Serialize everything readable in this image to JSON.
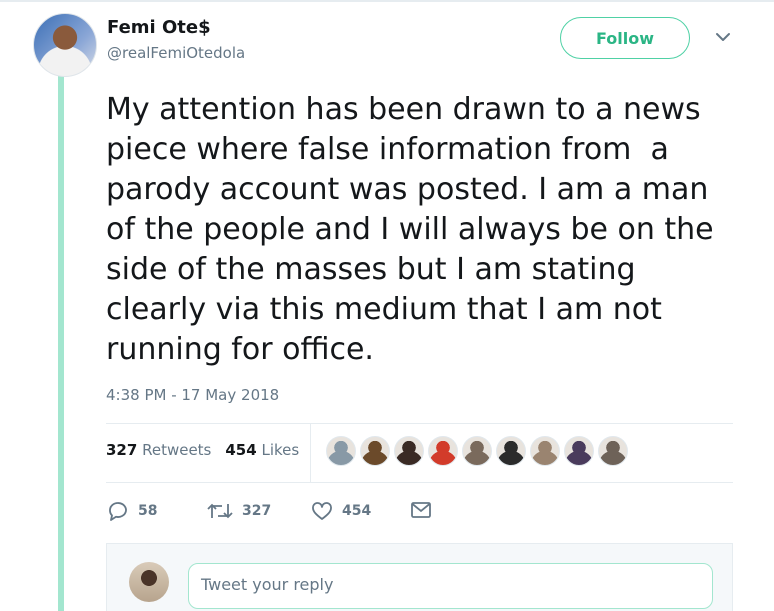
{
  "author": {
    "name": "Femi Ote$",
    "handle": "@realFemiOtedola"
  },
  "follow_button": {
    "label": "Follow"
  },
  "menu": {
    "icon": "chevron-down-icon"
  },
  "tweet": {
    "text": "My attention has been drawn to a news\npiece where false information from  a\nparody account was posted. I am a man\nof the people and I will always be on the\nside of the masses but I am stating\nclearly via this medium that I am not\nrunning for office.",
    "timestamp": "4:38 PM - 17 May 2018"
  },
  "stats": {
    "retweets_count": "327",
    "retweets_label": "Retweets",
    "likes_count": "454",
    "likes_label": "Likes"
  },
  "likers": [
    {
      "icon": "default-avatar",
      "color": "#8899a6"
    },
    {
      "icon": "avatar",
      "color": "#6b4a2a"
    },
    {
      "icon": "avatar",
      "color": "#3a2a24"
    },
    {
      "icon": "party-logo-avatar",
      "color": "#d23b2a"
    },
    {
      "icon": "avatar",
      "color": "#7a6a5c"
    },
    {
      "icon": "avatar",
      "color": "#2b2b2b"
    },
    {
      "icon": "avatar",
      "color": "#9a8470"
    },
    {
      "icon": "avatar",
      "color": "#4a3b5c"
    },
    {
      "icon": "avatar",
      "color": "#6e6258"
    }
  ],
  "actions": {
    "reply_count": "58",
    "retweet_count": "327",
    "like_count": "454"
  },
  "reply": {
    "placeholder": "Tweet your reply"
  },
  "colors": {
    "accent": "#2bb585",
    "accent_border": "#4fd1a5",
    "thread_line": "#a3e6cf",
    "muted_text": "#657786"
  }
}
